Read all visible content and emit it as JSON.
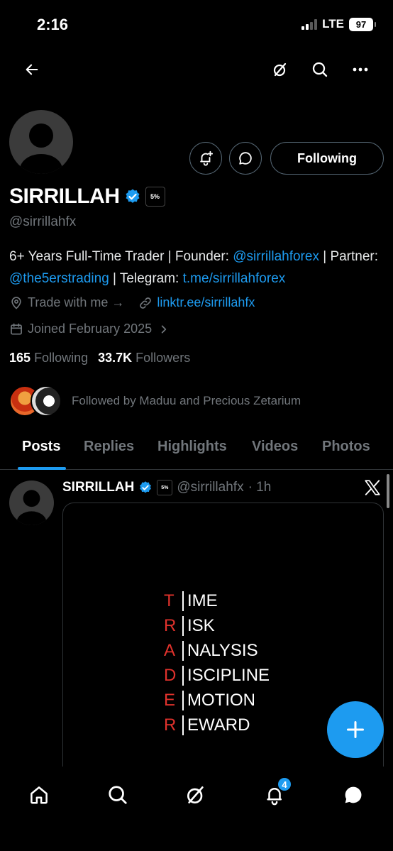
{
  "status": {
    "time": "2:16",
    "network": "LTE",
    "battery": "97"
  },
  "nav": {
    "back_icon": "back-arrow-icon",
    "grok_icon": "grok-icon",
    "search_icon": "search-icon",
    "more_icon": "more-icon"
  },
  "profile": {
    "name": "SIRRILLAH",
    "handle": "@sirrillahfx",
    "affiliate_badge": "5%",
    "following_button": "Following",
    "bio": {
      "part1": "6+ Years Full-Time Trader | Founder: ",
      "mention1": "@sirrillahforex",
      "part2": " | Partner: ",
      "mention2": "@the5erstrading",
      "part3": " | Telegram: ",
      "link": "t.me/sirrillahforex"
    },
    "location": "Trade with me →",
    "website": "linktr.ee/sirrillahfx",
    "joined": "Joined February 2025",
    "following_count": "165",
    "following_label": "Following",
    "followers_count": "33.7K",
    "followers_label": "Followers",
    "followed_by": "Followed by Maduu and Precious Zetarium"
  },
  "tabs": [
    "Posts",
    "Replies",
    "Highlights",
    "Videos",
    "Photos"
  ],
  "post": {
    "name": "SIRRILLAH",
    "handle": "@sirrillahfx",
    "time": "· 1h",
    "acronym": [
      {
        "letter": "T",
        "rest": "IME"
      },
      {
        "letter": "R",
        "rest": "ISK"
      },
      {
        "letter": "A",
        "rest": "NALYSIS"
      },
      {
        "letter": "D",
        "rest": "ISCIPLINE"
      },
      {
        "letter": "E",
        "rest": "MOTION"
      },
      {
        "letter": "R",
        "rest": "EWARD"
      }
    ]
  },
  "bottom_nav": {
    "notifications_badge": "4"
  },
  "colors": {
    "accent": "#1d9bf0",
    "acronym_letter": "#e0322c",
    "muted": "#71767b"
  }
}
